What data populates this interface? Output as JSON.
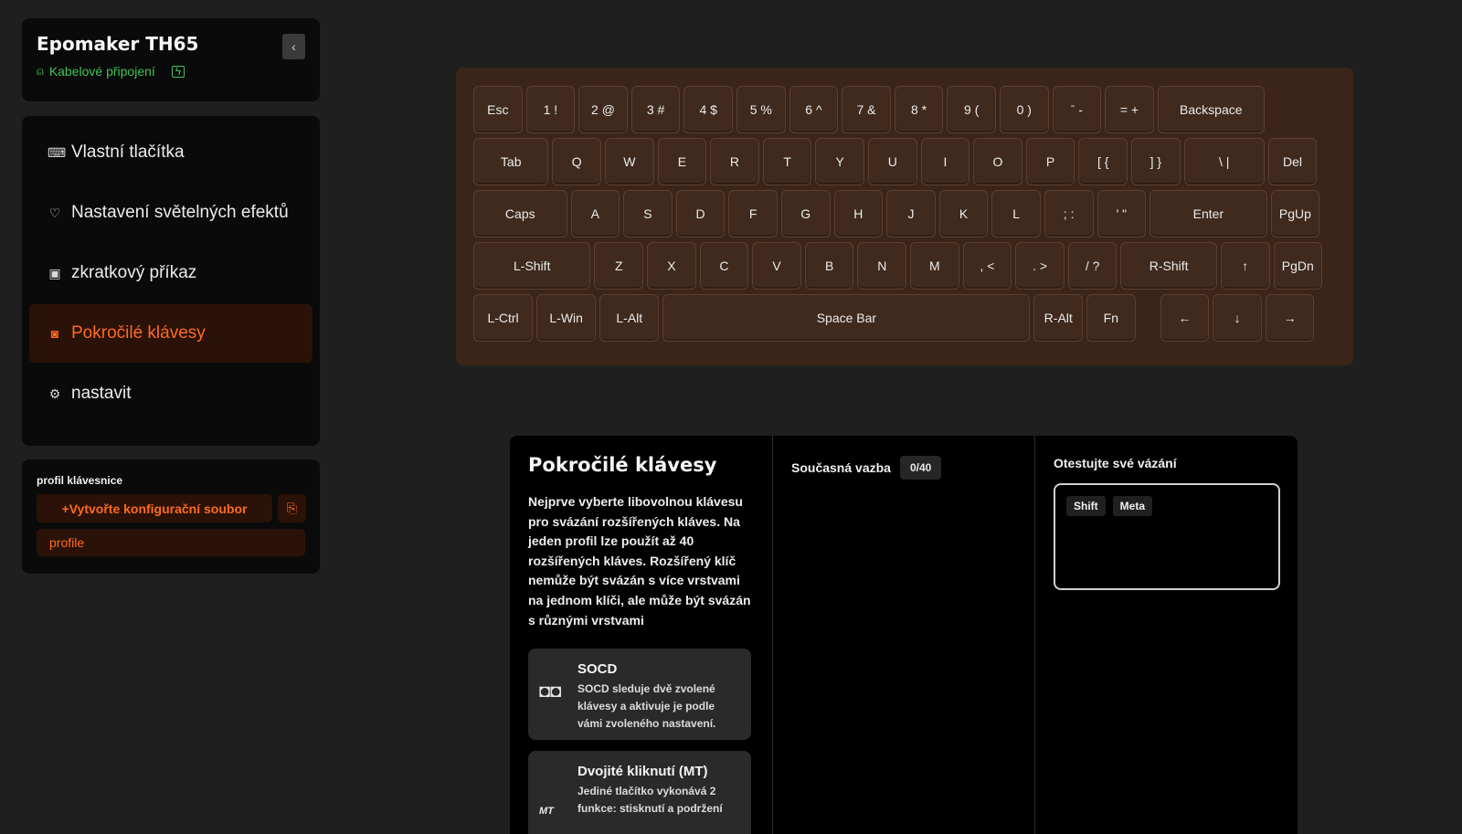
{
  "device": {
    "name": "Epomaker TH65",
    "collapse_icon": "‹",
    "connection": "Kabelové připojení"
  },
  "nav": {
    "items": [
      {
        "label": "Vlastní tlačítka",
        "icon": "keyboard-icon"
      },
      {
        "label": "Nastavení světelných efektů",
        "icon": "bulb-icon"
      },
      {
        "label": "zkratkový příkaz",
        "icon": "macro-icon"
      },
      {
        "label": "Pokročilé klávesy",
        "icon": "advanced-keys-icon",
        "active": true
      },
      {
        "label": "nastavit",
        "icon": "gear-icon"
      }
    ]
  },
  "profile": {
    "title": "profil klávesnice",
    "create_label": "+Vytvořte konfigurační soubor",
    "item": "profile"
  },
  "keyboard": {
    "rows": [
      [
        "Esc",
        "1 !",
        "2 @",
        "3 #",
        "4 $",
        "5 %",
        "6 ^",
        "7 &",
        "8 *",
        "9 (",
        "0 )",
        "ˉ -",
        "= +",
        "Backspace"
      ],
      [
        "Tab",
        "Q",
        "W",
        "E",
        "R",
        "T",
        "Y",
        "U",
        "I",
        "O",
        "P",
        "[ {",
        "] }",
        "\\ |",
        "Del"
      ],
      [
        "Caps",
        "A",
        "S",
        "D",
        "F",
        "G",
        "H",
        "J",
        "K",
        "L",
        "; :",
        "' \"",
        "Enter",
        "PgUp"
      ],
      [
        "L-Shift",
        "Z",
        "X",
        "C",
        "V",
        "B",
        "N",
        "M",
        ", <",
        ". >",
        "/ ?",
        "R-Shift",
        "↑",
        "PgDn"
      ],
      [
        "L-Ctrl",
        "L-Win",
        "L-Alt",
        "Space Bar",
        "R-Alt",
        "Fn",
        "←",
        "↓",
        "→"
      ]
    ]
  },
  "panel": {
    "title": "Pokročilé klávesy",
    "description": "Nejprve vyberte libovolnou klávesu pro svázání rozšířených kláves. Na jeden profil lze použít až 40 rozšířených kláves. Rozšířený klíč nemůže být svázán s více vrstvami na jednom klíči, ale může být svázán s různými vrstvami",
    "features": [
      {
        "name": "SOCD",
        "desc": "SOCD sleduje dvě zvolené klávesy a aktivuje je podle vámi zvoleného nastavení.",
        "icon_text": "◘◘"
      },
      {
        "name": "Dvojité kliknutí (MT)",
        "desc": "Jediné tlačítko vykonává 2 funkce: stisknutí a podržení",
        "icon_text": "MT"
      }
    ],
    "binding_label": "Současná vazba",
    "binding_count": "0/40",
    "test_title": "Otestujte své vázání",
    "modifiers": [
      "Shift",
      "Meta"
    ]
  }
}
